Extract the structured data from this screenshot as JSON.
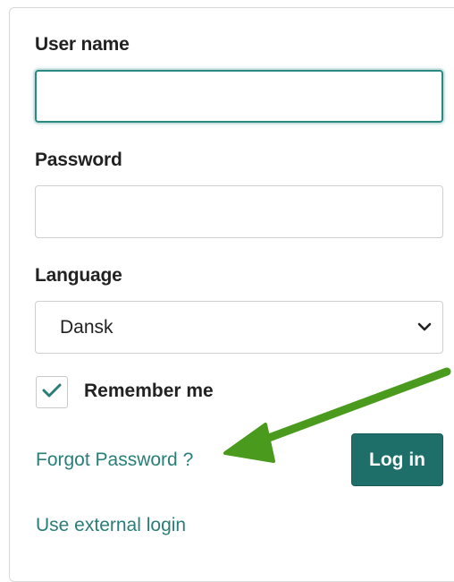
{
  "form": {
    "username_label": "User name",
    "username_value": "",
    "password_label": "Password",
    "password_value": "",
    "language_label": "Language",
    "language_selected": "Dansk",
    "remember_label": "Remember me",
    "remember_checked": true,
    "forgot_password_link": "Forgot Password ?",
    "login_button": "Log in",
    "external_login_link": "Use external login"
  },
  "colors": {
    "accent": "#2a8a83",
    "button_bg": "#1e6f6a",
    "link": "#2a7e78",
    "annotation_arrow": "#4a9a1e"
  },
  "icons": {
    "select_indicator": "chevron-down-icon",
    "checkbox_mark": "checkmark-icon",
    "annotation": "arrow-annotation"
  }
}
